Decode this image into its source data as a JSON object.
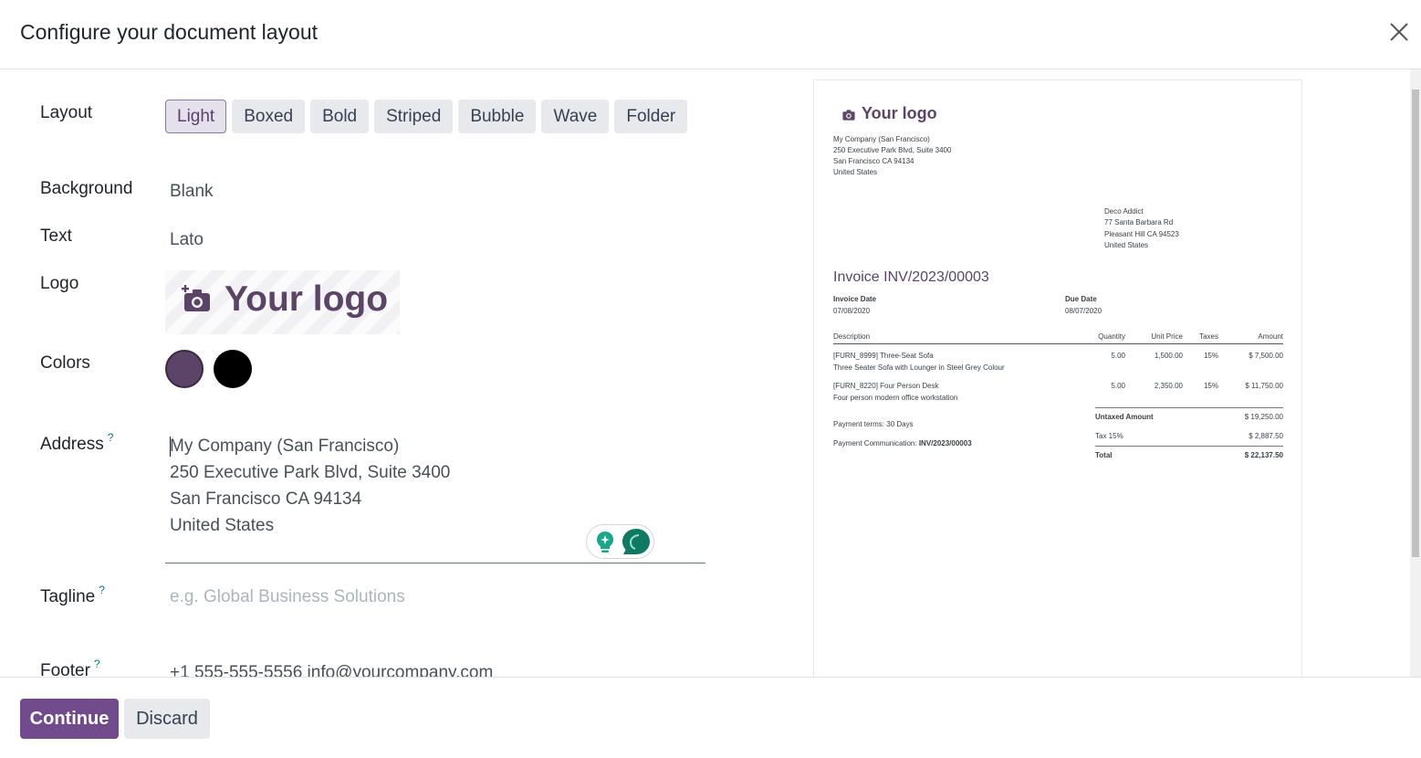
{
  "dialog": {
    "title": "Configure your document layout"
  },
  "form": {
    "layout": {
      "label": "Layout",
      "options": [
        "Light",
        "Boxed",
        "Bold",
        "Striped",
        "Bubble",
        "Wave",
        "Folder"
      ],
      "selected": "Light"
    },
    "background": {
      "label": "Background",
      "value": "Blank"
    },
    "text": {
      "label": "Text",
      "value": "Lato"
    },
    "logo": {
      "label": "Logo",
      "placeholder_text": "Your logo"
    },
    "colors": {
      "label": "Colors",
      "primary": "#5b4468",
      "secondary": "#000000"
    },
    "address": {
      "label": "Address",
      "help": "?",
      "lines": [
        "My Company (San Francisco)",
        "250 Executive Park Blvd, Suite 3400",
        "San Francisco CA 94134",
        "United States"
      ]
    },
    "tagline": {
      "label": "Tagline",
      "help": "?",
      "placeholder": "e.g. Global Business Solutions"
    },
    "footer": {
      "label": "Footer",
      "help": "?",
      "value": "+1 555-555-5556 info@yourcompany.com"
    }
  },
  "preview": {
    "logo_text": "Your logo",
    "company_lines": [
      "My Company (San Francisco)",
      "250 Executive Park Blvd, Suite 3400",
      "San Francisco CA 94134",
      "United States"
    ],
    "customer_lines": [
      "Deco Addict",
      "77 Santa Barbara Rd",
      "Pleasant Hill CA 94523",
      "United States"
    ],
    "invoice_title": "Invoice INV/2023/00003",
    "invoice_date_label": "Invoice Date",
    "invoice_date": "07/08/2020",
    "due_date_label": "Due Date",
    "due_date": "08/07/2020",
    "columns": [
      "Description",
      "Quantity",
      "Unit Price",
      "Taxes",
      "Amount"
    ],
    "rows": [
      {
        "desc": "[FURN_8999] Three-Seat Sofa",
        "sub": "Three Seater Sofa with Lounger in Steel Grey Colour",
        "qty": "5.00",
        "price": "1,500.00",
        "tax": "15%",
        "amount": "$ 7,500.00"
      },
      {
        "desc": "[FURN_8220] Four Person Desk",
        "sub": "Four person modern office workstation",
        "qty": "5.00",
        "price": "2,350.00",
        "tax": "15%",
        "amount": "$ 11,750.00"
      }
    ],
    "payment_terms": "Payment terms: 30 Days",
    "payment_comm_label": "Payment Communication:",
    "payment_comm_value": "INV/2023/00003",
    "untaxed_label": "Untaxed Amount",
    "untaxed_value": "$ 19,250.00",
    "tax_label": "Tax 15%",
    "tax_value": "$ 2,887.50",
    "total_label": "Total",
    "total_value": "$ 22,137.50"
  },
  "actions": {
    "continue": "Continue",
    "discard": "Discard"
  },
  "accent": "#714b8c"
}
